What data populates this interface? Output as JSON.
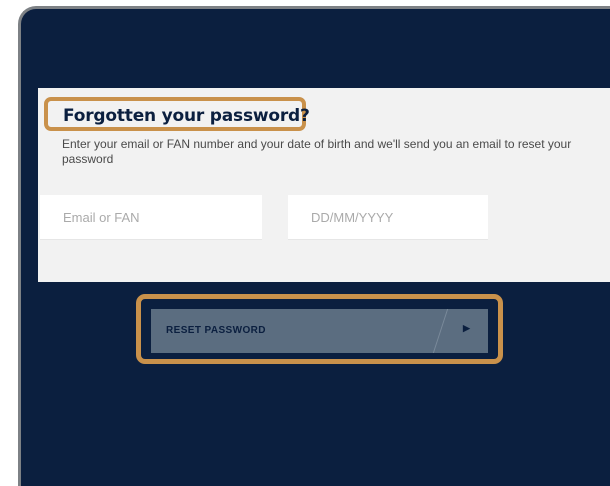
{
  "form": {
    "title": "Forgotten your password?",
    "description": "Enter your email or FAN number and your date of birth and we'll send you an email to reset your password",
    "email_placeholder": "Email or FAN",
    "dob_placeholder": "DD/MM/YYYY",
    "submit_label": "RESET PASSWORD",
    "submit_icon": "caret-right-icon"
  },
  "colors": {
    "background": "#0b1f3f",
    "panel": "#f2f2f2",
    "button": "#5b6d80",
    "highlight": "#c9914b"
  }
}
